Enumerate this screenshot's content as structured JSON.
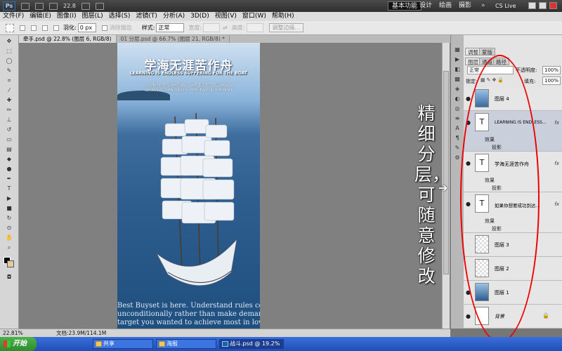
{
  "app": {
    "logo": "Ps",
    "zoom": "22.8"
  },
  "workspaces": [
    "基本功能",
    "设计",
    "绘画",
    "摄影"
  ],
  "cslive": "CS Live",
  "menu": [
    "文件(F)",
    "编辑(E)",
    "图像(I)",
    "图层(L)",
    "选择(S)",
    "滤镜(T)",
    "分析(A)",
    "3D(D)",
    "视图(V)",
    "窗口(W)",
    "帮助(H)"
  ],
  "options": {
    "feather_label": "羽化:",
    "feather_value": "0 px",
    "antialias": "消除锯齿",
    "style_label": "样式:",
    "style_value": "正常",
    "width_label": "宽度:",
    "height_label": "高度:",
    "refine_btn": "调整边缘..."
  },
  "tabs": [
    "牵手.psd @ 22.8% (图层 6, RGB/8)",
    "01 分层.psd @ 66.7% (图层 21, RGB/8) *"
  ],
  "poster": {
    "title_cn": "学海无涯苦作舟",
    "title_en": "LEARNING IS ENDLESS SUFFERING FOR THE BOAT",
    "tagline1": "如果你想要成功到达彼岸，就要勇往直前，坚持到底",
    "tagline2": "LEARNING IS ENDLESS SUFFERING FOR THE BOAT",
    "bottom_lines": [
      "Best Buyset is here. Understand rules completely and",
      "unconditionally rather than make demands on them,",
      "target you wanted to achieve most in love and"
    ]
  },
  "panel": {
    "tabs": [
      "调整",
      "蒙版"
    ],
    "tabs2": [
      "图层",
      "通道",
      "路径"
    ],
    "blend_mode": "正常",
    "opacity_label": "不透明度:",
    "opacity": "100%",
    "lock_label": "锁定:",
    "fill_label": "填充:",
    "fill": "100%",
    "layers": [
      {
        "name": "图层 4",
        "type": "image"
      },
      {
        "name": "LEARNING IS ENDLESS...",
        "type": "text",
        "fx": "fx",
        "effect": "效果",
        "sub": "投影"
      },
      {
        "name": "学海无涯苦作舟",
        "type": "text",
        "fx": "fx",
        "effect": "效果",
        "sub": "投影"
      },
      {
        "name": "如果你想要成功到达...",
        "type": "text",
        "fx": "fx",
        "effect": "效果",
        "sub": "投影"
      },
      {
        "name": "图层 3",
        "type": "empty"
      },
      {
        "name": "图层 2",
        "type": "empty"
      },
      {
        "name": "图层 1",
        "type": "image"
      },
      {
        "name": "背景",
        "type": "white"
      }
    ],
    "text_glyph": "T"
  },
  "note": "精细分层，可随意修改",
  "status": {
    "zoom": "22.81%",
    "doc": "文档:23.9M/114.1M"
  },
  "taskbar": {
    "start": "开始",
    "items": [
      "共享",
      "海报",
      "战斗.psd @ 19.2%"
    ]
  }
}
